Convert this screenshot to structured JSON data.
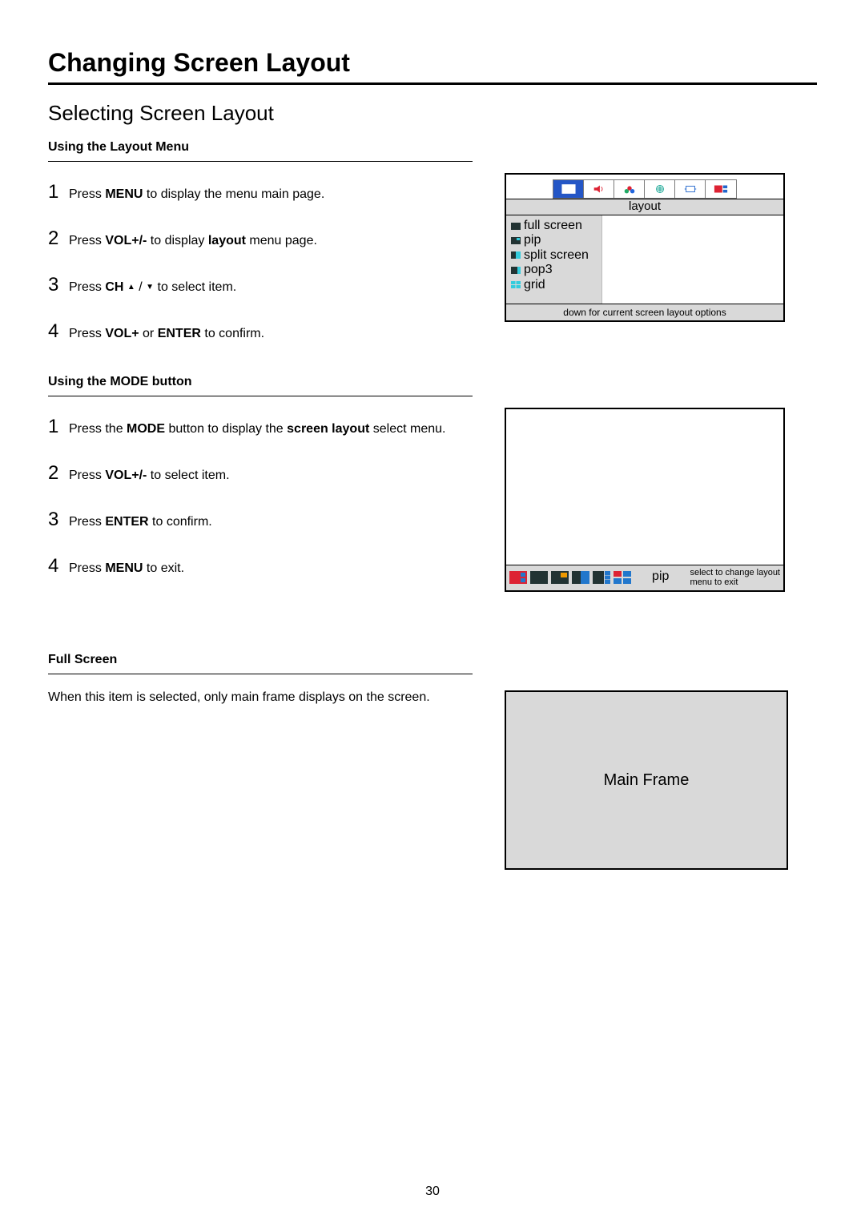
{
  "page_title": "Changing Screen Layout",
  "section_title": "Selecting Screen Layout",
  "page_number": "30",
  "layout_menu": {
    "heading": "Using the Layout Menu",
    "steps": {
      "s1": {
        "num": "1",
        "pre": "Press ",
        "b1": "MENU",
        "post": " to display the menu main page."
      },
      "s2": {
        "num": "2",
        "pre": "Press ",
        "b1": "VOL+/-",
        "mid": " to display ",
        "b2": "layout",
        "post": " menu page."
      },
      "s3": {
        "num": "3",
        "pre": "Press ",
        "b1": "CH",
        "post_icons": " to select item."
      },
      "s4": {
        "num": "4",
        "pre": "Press ",
        "b1": "VOL+",
        "mid": " or ",
        "b2": "ENTER",
        "post": " to confirm."
      }
    }
  },
  "osd": {
    "label": "layout",
    "items": {
      "i1": "full screen",
      "i2": "pip",
      "i3": "split screen",
      "i4": "pop3",
      "i5": "grid"
    },
    "footer": "down for current screen layout options"
  },
  "mode_button": {
    "heading": "Using the MODE button",
    "steps": {
      "s1": {
        "num": "1",
        "pre": "Press the ",
        "b1": "MODE",
        "mid": " button to display the ",
        "b2": "screen layout",
        "post": " select menu."
      },
      "s2": {
        "num": "2",
        "pre": "Press ",
        "b1": "VOL+/-",
        "post": " to select item."
      },
      "s3": {
        "num": "3",
        "pre": "Press ",
        "b1": "ENTER",
        "post": " to confirm."
      },
      "s4": {
        "num": "4",
        "pre": "Press ",
        "b1": "MENU",
        "post": " to exit."
      }
    },
    "strip_caption": "pip",
    "strip_hint": "select to change layout\nmenu to exit"
  },
  "full_screen": {
    "heading": "Full Screen",
    "description": "When this item is selected, only main frame displays on the screen.",
    "box_label": "Main Frame"
  }
}
